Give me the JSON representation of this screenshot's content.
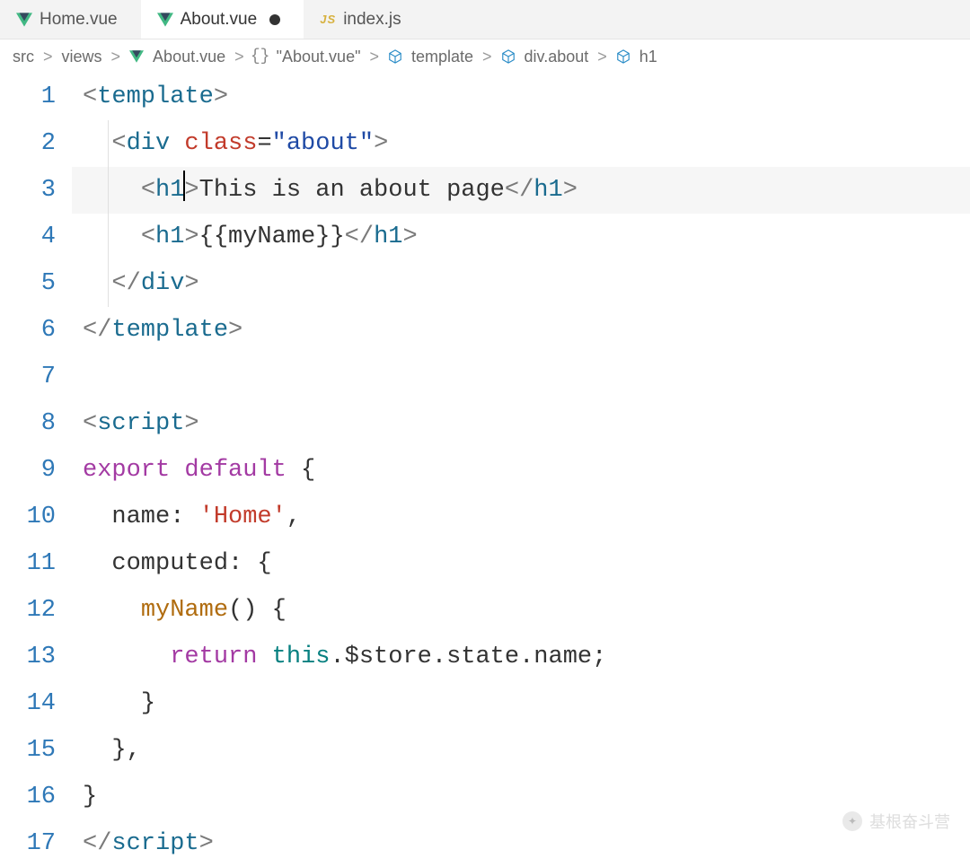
{
  "tabs": [
    {
      "label": "Home.vue",
      "icon": "vue",
      "active": false,
      "dirty": false
    },
    {
      "label": "About.vue",
      "icon": "vue",
      "active": true,
      "dirty": true
    },
    {
      "label": "index.js",
      "icon": "js",
      "active": false,
      "dirty": false
    }
  ],
  "jsIconText": "JS",
  "breadcrumb": [
    {
      "label": "src"
    },
    {
      "label": "views"
    },
    {
      "label": "About.vue",
      "icon": "vue"
    },
    {
      "label": "\"About.vue\"",
      "icon": "braces"
    },
    {
      "label": "template",
      "icon": "cube"
    },
    {
      "label": "div.about",
      "icon": "cube"
    },
    {
      "label": "h1",
      "icon": "cube"
    }
  ],
  "crumbSep": ">",
  "code": {
    "lineNumbers": [
      "1",
      "2",
      "3",
      "4",
      "5",
      "6",
      "7",
      "8",
      "9",
      "10",
      "11",
      "12",
      "13",
      "14",
      "15",
      "16",
      "17"
    ],
    "cursorLine": 3,
    "lines": [
      [
        {
          "c": "br",
          "t": "<"
        },
        {
          "c": "t",
          "t": "template"
        },
        {
          "c": "br",
          "t": ">"
        }
      ],
      [
        {
          "c": "pl",
          "t": "  "
        },
        {
          "c": "br",
          "t": "<"
        },
        {
          "c": "t",
          "t": "div"
        },
        {
          "c": "pl",
          "t": " "
        },
        {
          "c": "at",
          "t": "class"
        },
        {
          "c": "pu",
          "t": "="
        },
        {
          "c": "st",
          "t": "\"about\""
        },
        {
          "c": "br",
          "t": ">"
        }
      ],
      [
        {
          "c": "pl",
          "t": "    "
        },
        {
          "c": "br",
          "t": "<"
        },
        {
          "c": "t",
          "t": "h1"
        },
        {
          "caret": true
        },
        {
          "c": "br",
          "t": ">"
        },
        {
          "c": "pl",
          "t": "This is an about page"
        },
        {
          "c": "br",
          "t": "</"
        },
        {
          "c": "t",
          "t": "h1"
        },
        {
          "c": "br",
          "t": ">"
        }
      ],
      [
        {
          "c": "pl",
          "t": "    "
        },
        {
          "c": "br",
          "t": "<"
        },
        {
          "c": "t",
          "t": "h1"
        },
        {
          "c": "br",
          "t": ">"
        },
        {
          "c": "pu",
          "t": "{{"
        },
        {
          "c": "pl",
          "t": "myName"
        },
        {
          "c": "pu",
          "t": "}}"
        },
        {
          "c": "br",
          "t": "</"
        },
        {
          "c": "t",
          "t": "h1"
        },
        {
          "c": "br",
          "t": ">"
        }
      ],
      [
        {
          "c": "pl",
          "t": "  "
        },
        {
          "c": "br",
          "t": "</"
        },
        {
          "c": "t",
          "t": "div"
        },
        {
          "c": "br",
          "t": ">"
        }
      ],
      [
        {
          "c": "br",
          "t": "</"
        },
        {
          "c": "t",
          "t": "template"
        },
        {
          "c": "br",
          "t": ">"
        }
      ],
      [],
      [
        {
          "c": "br",
          "t": "<"
        },
        {
          "c": "t",
          "t": "script"
        },
        {
          "c": "br",
          "t": ">"
        }
      ],
      [
        {
          "c": "kw",
          "t": "export"
        },
        {
          "c": "pl",
          "t": " "
        },
        {
          "c": "kw",
          "t": "default"
        },
        {
          "c": "pl",
          "t": " "
        },
        {
          "c": "pu",
          "t": "{"
        }
      ],
      [
        {
          "c": "pl",
          "t": "  "
        },
        {
          "c": "pl",
          "t": "name"
        },
        {
          "c": "pu",
          "t": ": "
        },
        {
          "c": "at",
          "t": "'Home'"
        },
        {
          "c": "pu",
          "t": ","
        }
      ],
      [
        {
          "c": "pl",
          "t": "  "
        },
        {
          "c": "pl",
          "t": "computed"
        },
        {
          "c": "pu",
          "t": ": {"
        }
      ],
      [
        {
          "c": "pl",
          "t": "    "
        },
        {
          "c": "pr",
          "t": "myName"
        },
        {
          "c": "pu",
          "t": "() {"
        }
      ],
      [
        {
          "c": "pl",
          "t": "      "
        },
        {
          "c": "kw",
          "t": "return"
        },
        {
          "c": "pl",
          "t": " "
        },
        {
          "c": "fn",
          "t": "this"
        },
        {
          "c": "pu",
          "t": "."
        },
        {
          "c": "pl",
          "t": "$store"
        },
        {
          "c": "pu",
          "t": "."
        },
        {
          "c": "pl",
          "t": "state"
        },
        {
          "c": "pu",
          "t": "."
        },
        {
          "c": "pl",
          "t": "name"
        },
        {
          "c": "pu",
          "t": ";"
        }
      ],
      [
        {
          "c": "pl",
          "t": "    "
        },
        {
          "c": "pu",
          "t": "}"
        }
      ],
      [
        {
          "c": "pl",
          "t": "  "
        },
        {
          "c": "pu",
          "t": "},"
        }
      ],
      [
        {
          "c": "pu",
          "t": "}"
        }
      ],
      [
        {
          "c": "br",
          "t": "</"
        },
        {
          "c": "t",
          "t": "script"
        },
        {
          "c": "br",
          "t": ">"
        }
      ]
    ]
  },
  "watermark": "基根奋斗营"
}
